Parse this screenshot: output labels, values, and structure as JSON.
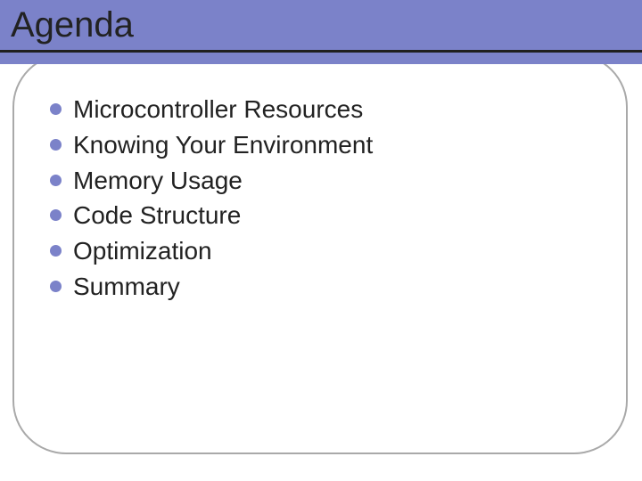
{
  "slide": {
    "title": "Agenda",
    "bullets": [
      "Microcontroller Resources",
      "Knowing Your Environment",
      "Memory Usage",
      "Code Structure",
      "Optimization",
      "Summary"
    ]
  },
  "colors": {
    "accent": "#7b82c9",
    "text": "#222222",
    "frame": "#a9a9a9"
  }
}
